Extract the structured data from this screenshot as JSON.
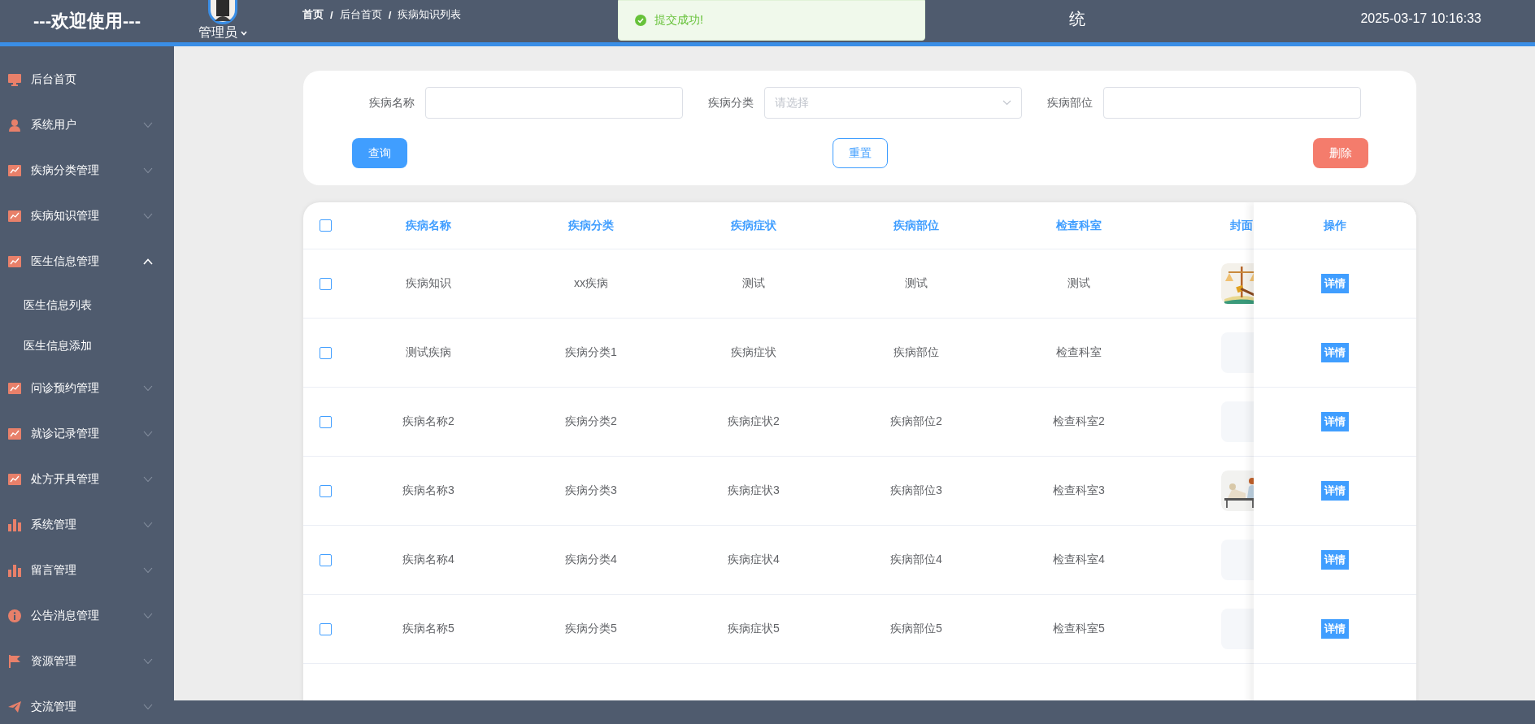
{
  "header": {
    "brand": "---欢迎使用---",
    "user": "管理员",
    "breadcrumb": [
      "首页",
      "后台首页",
      "疾病知识列表"
    ],
    "separator": "/",
    "title_fragment": "统",
    "datetime": "2025-03-17 10:16:33"
  },
  "toast": {
    "message": "提交成功!"
  },
  "sidebar": {
    "items": [
      {
        "label": "后台首页",
        "kind": "monitor"
      },
      {
        "label": "系统用户",
        "kind": "user",
        "expanded": false
      },
      {
        "label": "疾病分类管理",
        "kind": "chart",
        "expanded": false
      },
      {
        "label": "疾病知识管理",
        "kind": "chart",
        "expanded": false
      },
      {
        "label": "医生信息管理",
        "kind": "chart",
        "expanded": true,
        "children": [
          {
            "label": "医生信息列表"
          },
          {
            "label": "医生信息添加"
          }
        ]
      },
      {
        "label": "问诊预约管理",
        "kind": "chart",
        "expanded": false
      },
      {
        "label": "就诊记录管理",
        "kind": "chart",
        "expanded": false
      },
      {
        "label": "处方开具管理",
        "kind": "chart",
        "expanded": false
      },
      {
        "label": "系统管理",
        "kind": "bars",
        "expanded": false
      },
      {
        "label": "留言管理",
        "kind": "bars",
        "expanded": false
      },
      {
        "label": "公告消息管理",
        "kind": "info",
        "expanded": false
      },
      {
        "label": "资源管理",
        "kind": "flag",
        "expanded": false
      },
      {
        "label": "交流管理",
        "kind": "plane",
        "expanded": false
      }
    ]
  },
  "search": {
    "fields": [
      {
        "label": "疾病名称",
        "kind": "input"
      },
      {
        "label": "疾病分类",
        "kind": "select",
        "placeholder": "请选择"
      },
      {
        "label": "疾病部位",
        "kind": "input"
      }
    ],
    "buttons": [
      {
        "label": "查询",
        "kind": "primary"
      },
      {
        "label": "重置",
        "kind": "plain"
      },
      {
        "label": "删除",
        "kind": "danger"
      }
    ]
  },
  "table": {
    "all_selected": false,
    "columns": [
      "疾病名称",
      "疾病分类",
      "疾病症状",
      "疾病部位",
      "检查科室",
      "封面"
    ],
    "action_column": "操作",
    "rows": [
      {
        "selected": false,
        "cells": [
          "疾病知识",
          "xx疾病",
          "测试",
          "测试",
          "测试"
        ],
        "cover": {
          "kind": "picture"
        },
        "action": "详情"
      },
      {
        "selected": false,
        "cells": [
          "测试疾病",
          "疾病分类1",
          "疾病症状",
          "疾病部位",
          "检查科室"
        ],
        "cover": {
          "kind": "empty"
        },
        "action": "详情"
      },
      {
        "selected": false,
        "cells": [
          "疾病名称2",
          "疾病分类2",
          "疾病症状2",
          "疾病部位2",
          "检查科室2"
        ],
        "cover": {
          "kind": "empty"
        },
        "action": "详情"
      },
      {
        "selected": false,
        "cells": [
          "疾病名称3",
          "疾病分类3",
          "疾病症状3",
          "疾病部位3",
          "检查科室3"
        ],
        "cover": {
          "kind": "picture"
        },
        "action": "详情"
      },
      {
        "selected": false,
        "cells": [
          "疾病名称4",
          "疾病分类4",
          "疾病症状4",
          "疾病部位4",
          "检查科室4"
        ],
        "cover": {
          "kind": "empty"
        },
        "action": "详情"
      },
      {
        "selected": false,
        "cells": [
          "疾病名称5",
          "疾病分类5",
          "疾病症状5",
          "疾病部位5",
          "检查科室5"
        ],
        "cover": {
          "kind": "empty"
        },
        "action": "详情"
      }
    ]
  }
}
